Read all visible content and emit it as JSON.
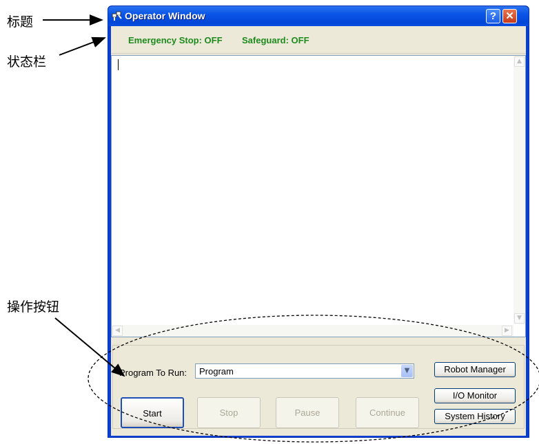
{
  "annotations": {
    "title_label": "标题",
    "status_label": "状态栏",
    "buttons_label": "操作按钮"
  },
  "window": {
    "title": "Operator Window",
    "help_glyph": "?",
    "close_glyph": "✕"
  },
  "status": {
    "emergency_stop": "Emergency Stop: OFF",
    "safeguard": "Safeguard: OFF",
    "color": "#1d8a1d"
  },
  "controls": {
    "program_label": "Program To Run:",
    "program_value": "Program",
    "start": "Start",
    "stop": "Stop",
    "pause": "Pause",
    "continue": "Continue",
    "robot_manager": "Robot Manager",
    "io_monitor": "I/O Monitor",
    "system_history": "System History"
  }
}
